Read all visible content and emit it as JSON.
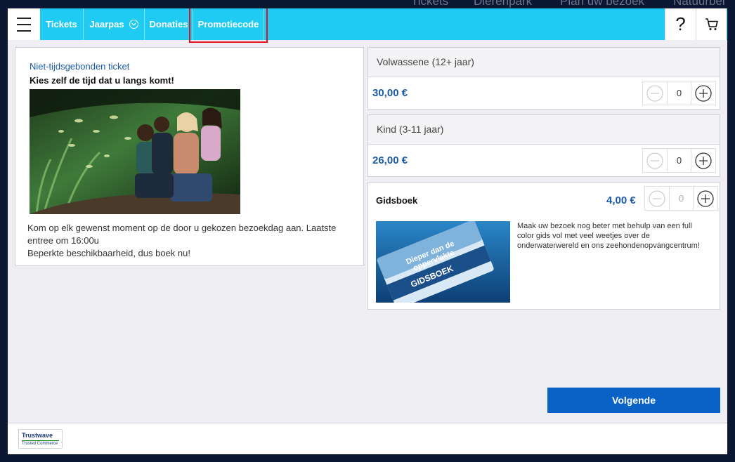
{
  "background_nav": [
    "Tickets",
    "Dierenpark",
    "Plan uw bezoek",
    "Natuurbel"
  ],
  "nav": {
    "menu_icon": "hamburger-icon",
    "items": [
      {
        "label": "Tickets"
      },
      {
        "label": "Jaarpas",
        "icon": "chevron-down-circle-icon"
      },
      {
        "label": "Donaties"
      },
      {
        "label": "Promotiecode"
      }
    ],
    "help_label": "?",
    "cart_icon": "cart-icon"
  },
  "ticket": {
    "title": "Niet-tijdsgebonden ticket",
    "subtitle": "Kies zelf de tijd dat u langs komt!",
    "desc_line1": "Kom op elk gewenst moment op de door u gekozen bezoekdag aan. Laatste entree om 16:00u",
    "desc_line2": "Beperkte beschikbaarheid, dus boek nu!"
  },
  "prices": [
    {
      "label": "Volwassene (12+ jaar)",
      "price": "30,00 €",
      "qty": "0"
    },
    {
      "label": "Kind (3-11 jaar)",
      "price": "26,00 €",
      "qty": "0"
    }
  ],
  "guide": {
    "title": "Gidsboek",
    "price": "4,00 €",
    "qty": "0",
    "description": "Maak uw bezoek nog beter met behulp van een full color gids vol met veel weetjes over de onderwaterwereld en ons zeehondenopvangcentrum!",
    "cover_line1": "Dieper dan de",
    "cover_line2": "oppervlakte",
    "cover_label": "GIDSBOEK"
  },
  "next_label": "Volgende",
  "trustwave": {
    "name": "Trustwave",
    "tagline": "Trusted Commerce"
  },
  "colors": {
    "accent": "#20cbf3",
    "primary": "#0a62c6",
    "price": "#1a5aa8",
    "highlight": "#e0141e"
  }
}
